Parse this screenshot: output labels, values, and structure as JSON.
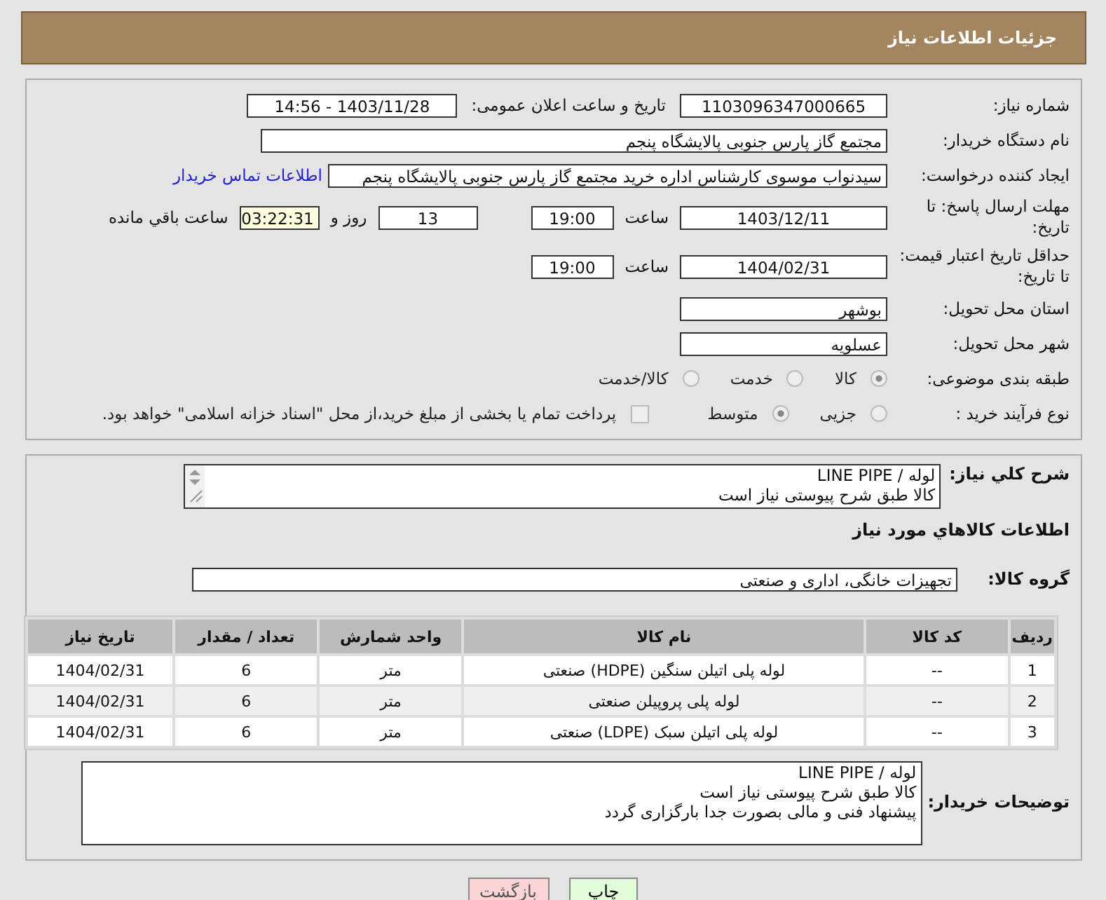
{
  "header": {
    "title": "جزئیات اطلاعات نیاز"
  },
  "need_number": {
    "label": "شماره نیاز:",
    "value": "1103096347000665"
  },
  "announce": {
    "label": "تاریخ و ساعت اعلان عمومی:",
    "value": "1403/11/28 - 14:56"
  },
  "buyer": {
    "label": "نام دستگاه خریدار:",
    "value": "مجتمع گاز پارس جنوبی  پالایشگاه پنجم"
  },
  "creator": {
    "label": "ایجاد کننده درخواست:",
    "value": "سیدنواب موسوی کارشناس اداره خرید مجتمع گاز پارس جنوبی  پالایشگاه پنجم",
    "link": "اطلاعات تماس خریدار"
  },
  "reply_deadline": {
    "label": "مهلت ارسال پاسخ: تا تاریخ:",
    "date": "1403/12/11",
    "time_label": "ساعت",
    "time": "19:00",
    "days": "13",
    "days_label": "روز و",
    "remaining": "03:22:31",
    "remaining_label": "ساعت باقي مانده"
  },
  "price_validity": {
    "label": "حداقل تاریخ اعتبار قیمت: تا تاریخ:",
    "date": "1404/02/31",
    "time_label": "ساعت",
    "time": "19:00"
  },
  "province": {
    "label": "استان محل تحویل:",
    "value": "بوشهر"
  },
  "city": {
    "label": "شهر محل تحویل:",
    "value": "عسلویه"
  },
  "category": {
    "label": "طبقه بندی موضوعی:",
    "options": [
      {
        "label": "کالا",
        "selected": true
      },
      {
        "label": "خدمت",
        "selected": false
      },
      {
        "label": "کالا/خدمت",
        "selected": false
      }
    ]
  },
  "purchase_type": {
    "label": "نوع فرآیند خرید :",
    "options": [
      {
        "label": "جزیی",
        "selected": false
      },
      {
        "label": "متوسط",
        "selected": true
      }
    ],
    "treasury": {
      "label": "پرداخت تمام یا بخشی از مبلغ خرید،از محل \"اسناد خزانه اسلامی\" خواهد بود.",
      "checked": false
    }
  },
  "description": {
    "label": "شرح کلي نياز:",
    "lines": [
      "لوله / LINE PIPE",
      "کالا طبق شرح پیوستی نیاز است"
    ]
  },
  "goods_section": {
    "title": "اطلاعات کالاهاي مورد نياز"
  },
  "goods_group": {
    "label": "گروه کالا:",
    "value": "تجهیزات خانگی، اداری و صنعتی"
  },
  "table": {
    "columns": [
      "ردیف",
      "کد کالا",
      "نام کالا",
      "واحد شمارش",
      "تعداد / مقدار",
      "تاریخ نیاز"
    ],
    "rows": [
      [
        "1",
        "--",
        "لوله پلی اتیلن سنگین (HDPE) صنعتی",
        "متر",
        "6",
        "1404/02/31"
      ],
      [
        "2",
        "--",
        "لوله پلی پروپیلن صنعتی",
        "متر",
        "6",
        "1404/02/31"
      ],
      [
        "3",
        "--",
        "لوله پلی اتیلن سبک (LDPE) صنعتی",
        "متر",
        "6",
        "1404/02/31"
      ]
    ]
  },
  "buyer_notes": {
    "label": "توضیحات خریدار:",
    "lines": [
      "لوله / LINE PIPE",
      "کالا طبق شرح پیوستی نیاز است",
      "پیشنهاد فنی و مالی بصورت جدا بارگزاری گردد"
    ]
  },
  "buttons": [
    {
      "label": "چاپ",
      "kind": "print"
    },
    {
      "label": "بازگشت",
      "kind": "back"
    }
  ]
}
